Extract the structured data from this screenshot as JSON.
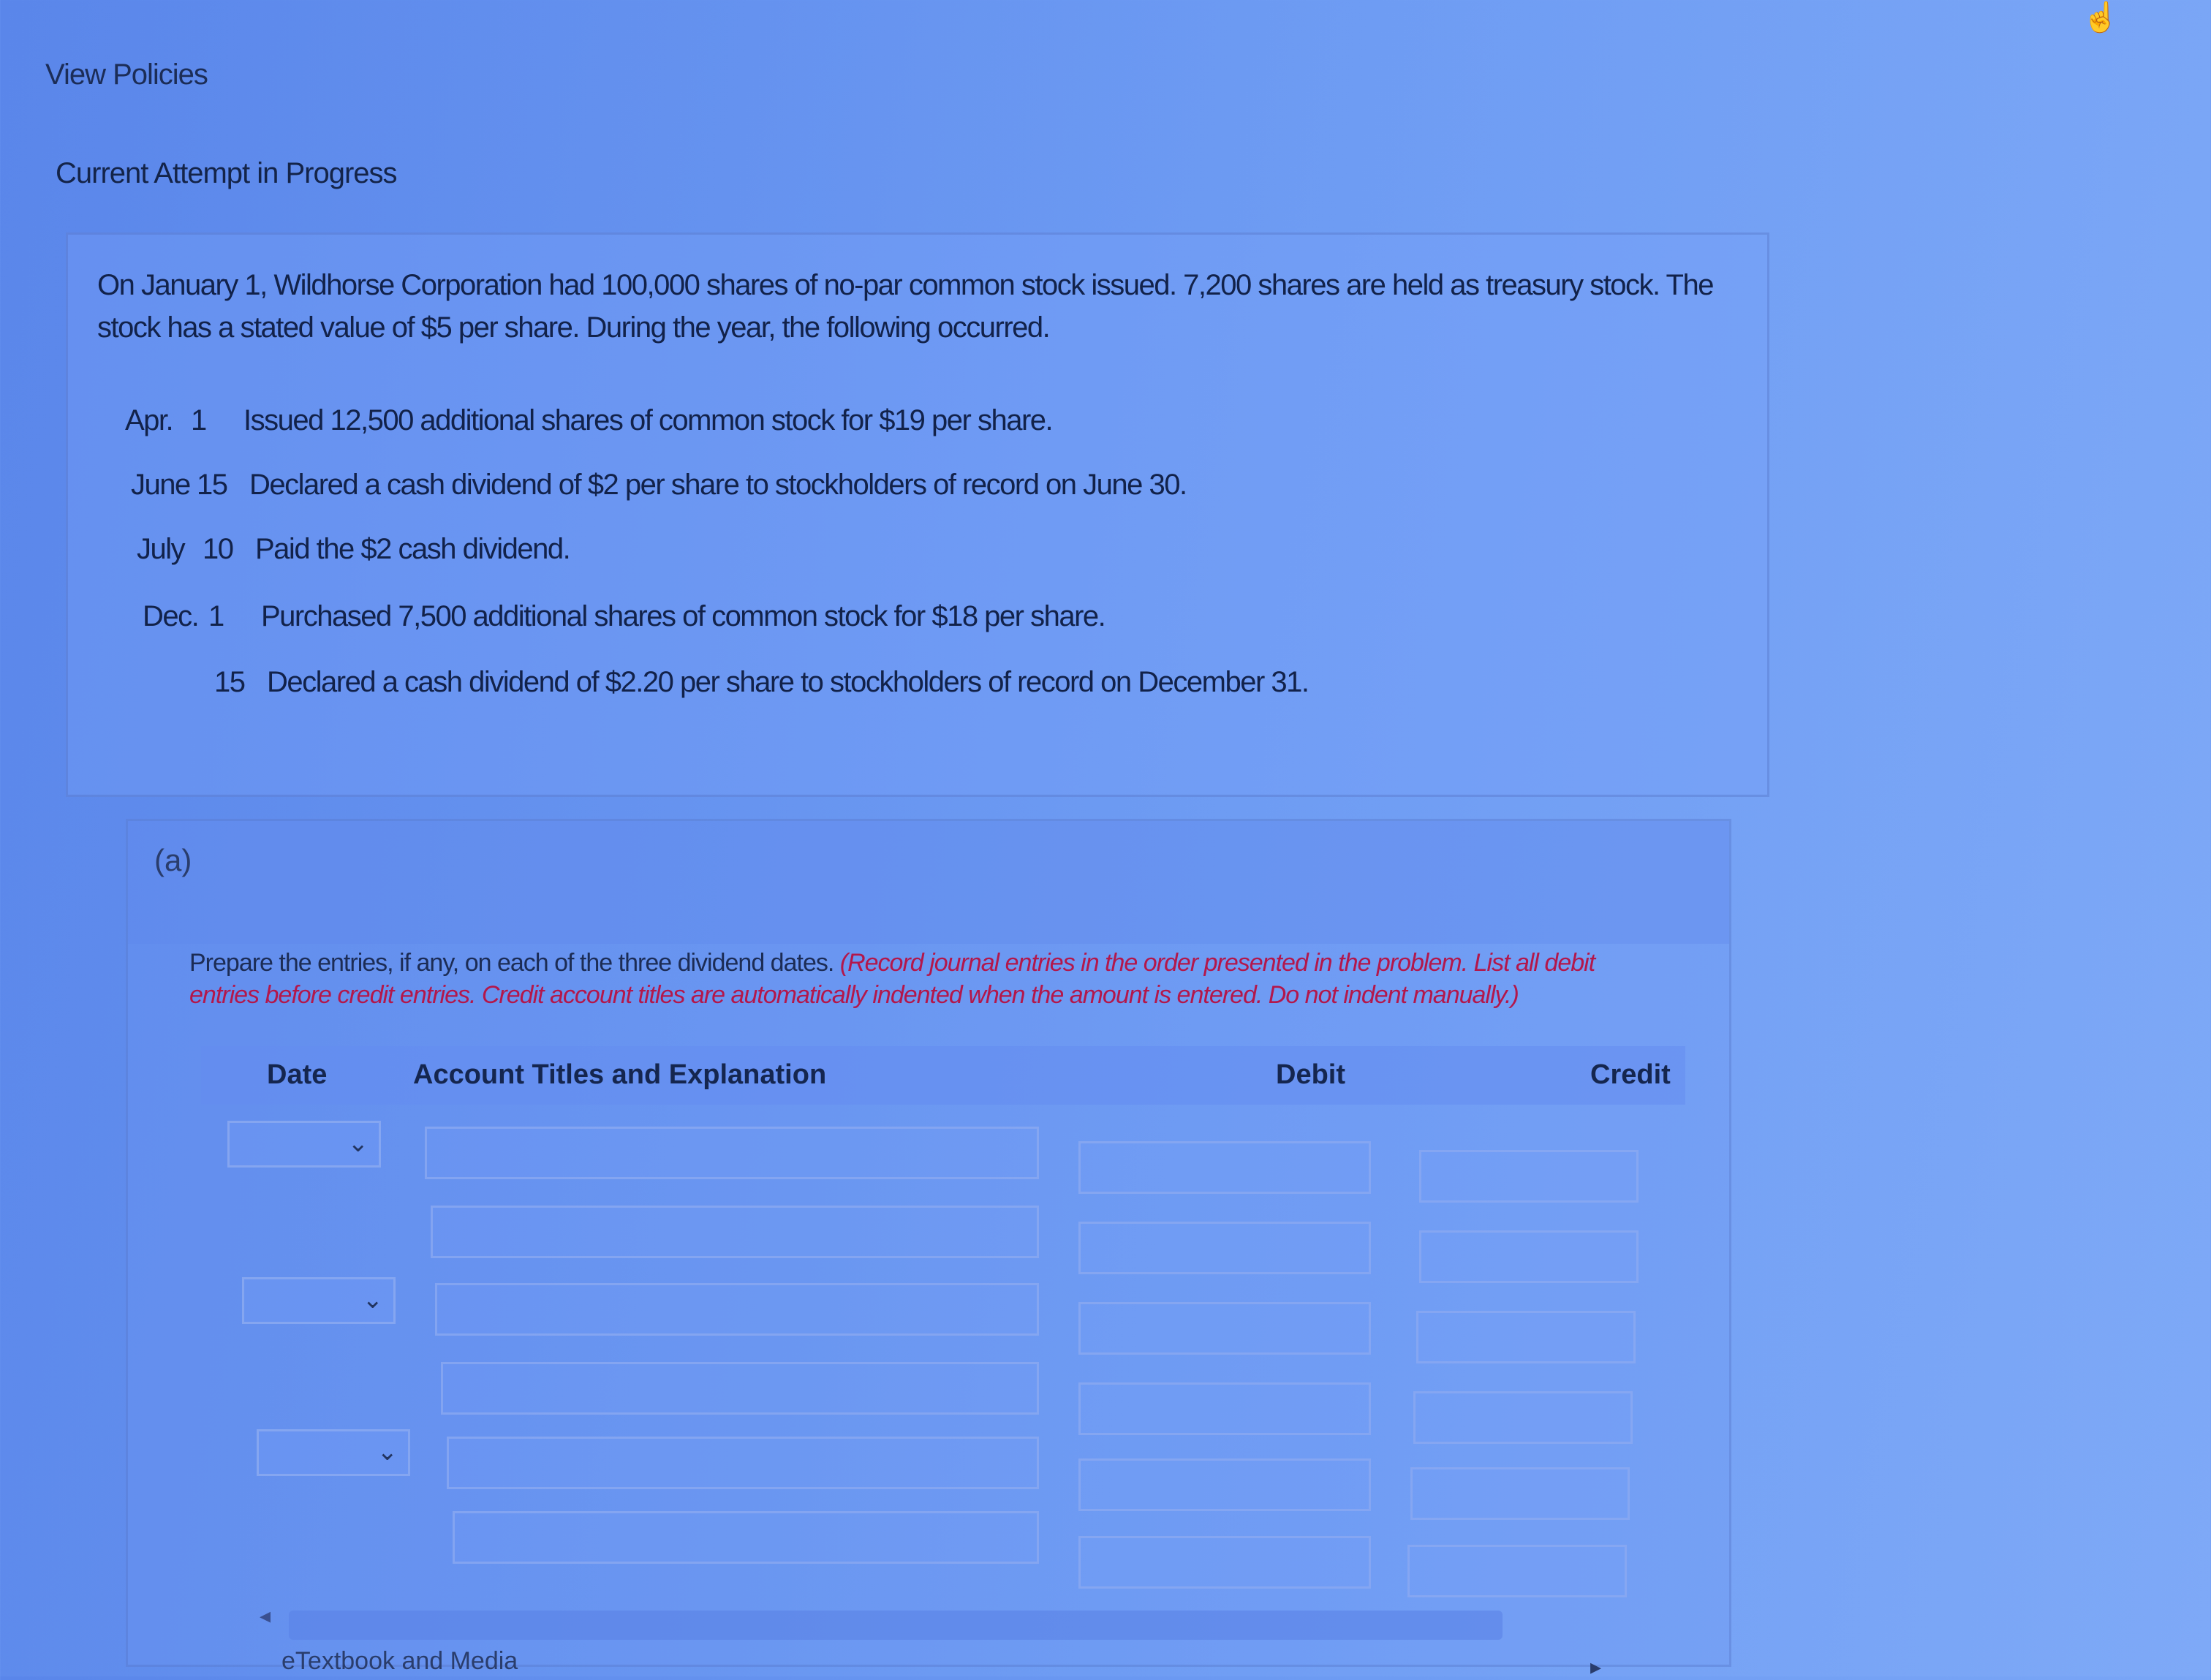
{
  "header": {
    "view_policies": "View Policies",
    "attempt_label": "Current Attempt in Progress"
  },
  "problem": {
    "intro": "On January 1, Wildhorse Corporation had 100,000 shares of no-par common stock issued. 7,200 shares are held as treasury stock. The stock has a stated value of $5 per share. During the year, the following occurred.",
    "transactions": [
      {
        "month": "Apr.",
        "day": "1",
        "text": "Issued 12,500 additional shares of common stock for $19 per share."
      },
      {
        "month": "June",
        "day": "15",
        "text": "Declared a cash dividend of $2 per share to stockholders of record on June 30."
      },
      {
        "month": "July",
        "day": "10",
        "text": "Paid the $2 cash dividend."
      },
      {
        "month": "Dec.",
        "day": "1",
        "text": "Purchased 7,500 additional shares of common stock for $18 per share."
      },
      {
        "month": "",
        "day": "15",
        "text": "Declared a cash dividend of $2.20 per share to stockholders of record on December 31."
      }
    ]
  },
  "part_a": {
    "label": "(a)",
    "instruction_plain": "Prepare the entries, if any, on each of the three dividend dates. ",
    "instruction_emph": "(Record journal entries in the order presented in the problem. List all debit entries before credit entries. Credit account titles are automatically indented when the amount is entered. Do not indent manually.)",
    "columns": {
      "date": "Date",
      "account": "Account Titles and Explanation",
      "debit": "Debit",
      "credit": "Credit"
    },
    "date_dropdown_values": [
      "",
      "",
      ""
    ],
    "footer_link": "eTextbook and Media"
  }
}
